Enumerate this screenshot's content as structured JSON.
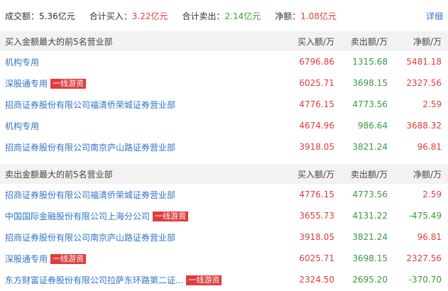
{
  "summary": {
    "turnover_label": "成交额：",
    "turnover_value": "5.36亿元",
    "buy_label": "合计买入：",
    "buy_value": "3.22亿元",
    "sell_label": "合计卖出：",
    "sell_value": "2.14亿元",
    "net_label": "净额：",
    "net_value": "1.08亿元",
    "detail_link": "详细"
  },
  "buy_section": {
    "title": "买入金额最大的前5名营业部",
    "col_buy": "买入额/万",
    "col_sell": "卖出额/万",
    "col_net": "净额/万",
    "rows": [
      {
        "name": "机构专用",
        "badge": "",
        "buy": "6796.86",
        "sell": "1315.68",
        "net": "5481.18"
      },
      {
        "name": "深股通专用",
        "badge": "一线游资",
        "buy": "6025.71",
        "sell": "3698.15",
        "net": "2327.56"
      },
      {
        "name": "招商证券股份有限公司福清侨荣城证券营业部",
        "badge": "",
        "buy": "4776.15",
        "sell": "4773.56",
        "net": "2.59"
      },
      {
        "name": "机构专用",
        "badge": "",
        "buy": "4674.96",
        "sell": "986.64",
        "net": "3688.32"
      },
      {
        "name": "招商证券股份有限公司南京庐山路证券营业部",
        "badge": "",
        "buy": "3918.05",
        "sell": "3821.24",
        "net": "96.81"
      }
    ]
  },
  "sell_section": {
    "title": "卖出金额最大的前5名营业部",
    "col_buy": "买入额/万",
    "col_sell": "卖出额/万",
    "col_net": "净额/万",
    "rows": [
      {
        "name": "招商证券股份有限公司福清侨荣城证券营业部",
        "badge": "",
        "buy": "4776.15",
        "sell": "4773.56",
        "net": "2.59"
      },
      {
        "name": "中国国际金融股份有限公司上海分公司",
        "badge": "一线游资",
        "buy": "3655.73",
        "sell": "4131.22",
        "net": "-475.49"
      },
      {
        "name": "招商证券股份有限公司南京庐山路证券营业部",
        "badge": "",
        "buy": "3918.05",
        "sell": "3821.24",
        "net": "96.81"
      },
      {
        "name": "深股通专用",
        "badge": "一线游资",
        "buy": "6025.71",
        "sell": "3698.15",
        "net": "2327.56"
      },
      {
        "name": "东方财富证券股份有限公司拉萨东环路第二证...",
        "badge": "一线游资",
        "buy": "2324.50",
        "sell": "2695.20",
        "net": "-370.70"
      }
    ]
  },
  "colors": {
    "buy": "#e23c3c",
    "sell": "#3a9b3a",
    "link": "#2f75c8",
    "badge_bg": "#e23c3c"
  }
}
